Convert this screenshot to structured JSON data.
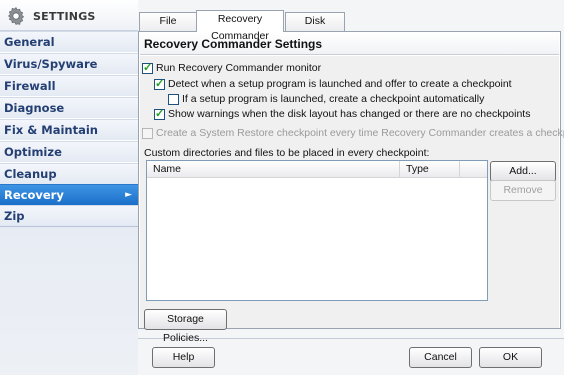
{
  "sidebar": {
    "title": "SETTINGS",
    "items": [
      {
        "label": "General"
      },
      {
        "label": "Virus/Spyware"
      },
      {
        "label": "Firewall"
      },
      {
        "label": "Diagnose"
      },
      {
        "label": "Fix & Maintain"
      },
      {
        "label": "Optimize"
      },
      {
        "label": "Cleanup"
      },
      {
        "label": "Recovery",
        "active": true
      },
      {
        "label": "Zip"
      }
    ],
    "active_arrow": "►"
  },
  "tabs": [
    {
      "label": "File Undeleter"
    },
    {
      "label": "Recovery Commander",
      "active": true
    },
    {
      "label": "Disk Snapshot"
    }
  ],
  "panel": {
    "title": "Recovery Commander Settings",
    "options": {
      "run_monitor": {
        "label": "Run Recovery Commander monitor",
        "checked": true
      },
      "detect_setup": {
        "label": "Detect when a setup program is launched and offer to create a checkpoint",
        "checked": true
      },
      "auto_checkpoint": {
        "label": "If a setup program is launched, create a checkpoint automatically",
        "checked": false
      },
      "show_warnings": {
        "label": "Show warnings when the disk layout has changed or there are no checkpoints",
        "checked": true
      },
      "system_restore": {
        "label": "Create a System Restore checkpoint every time Recovery Commander creates a checkpoint",
        "checked": false,
        "disabled": true
      }
    },
    "list_label": "Custom directories and files to be placed in every checkpoint:",
    "columns": {
      "name": "Name",
      "type": "Type"
    },
    "add_button": "Add...",
    "remove_button": "Remove",
    "storage_button": "Storage Policies..."
  },
  "footer": {
    "help": "Help",
    "cancel": "Cancel",
    "ok": "OK"
  },
  "colors": {
    "accent": "#1a6fc9",
    "sidebar_text": "#243f73",
    "check": "#21a121"
  }
}
